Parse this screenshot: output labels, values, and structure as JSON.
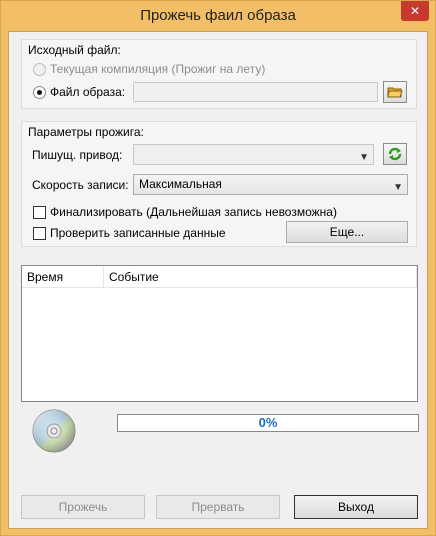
{
  "window": {
    "title": "Прожечь фаил образа",
    "close_glyph": "✕"
  },
  "source": {
    "title": "Исходный файл:",
    "radio_current_label": "Текущая компиляция (Прожиг на лету)",
    "radio_image_label": "Файл образа:",
    "image_path": ""
  },
  "burn": {
    "title": "Параметры прожига:",
    "drive_label": "Пишущ. привод:",
    "drive_value": "",
    "speed_label": "Скорость записи:",
    "speed_value": "Максимальная",
    "finalize_label": "Финализировать (Дальнейшая запись невозможна)",
    "verify_label": "Проверить записанные данные",
    "more_button": "Еще..."
  },
  "log": {
    "columns": [
      "Время",
      "Событие"
    ]
  },
  "progress": {
    "percent": 0,
    "text": "0%"
  },
  "actions": {
    "burn": "Прожечь",
    "abort": "Прервать",
    "exit": "Выход"
  },
  "colors": {
    "frame": "#f2bf67",
    "close": "#c7382d",
    "progress_text": "#1e6ec8"
  },
  "icons": {
    "open_folder": "folder-open-icon",
    "refresh": "refresh-icon",
    "disc": "disc-icon"
  }
}
